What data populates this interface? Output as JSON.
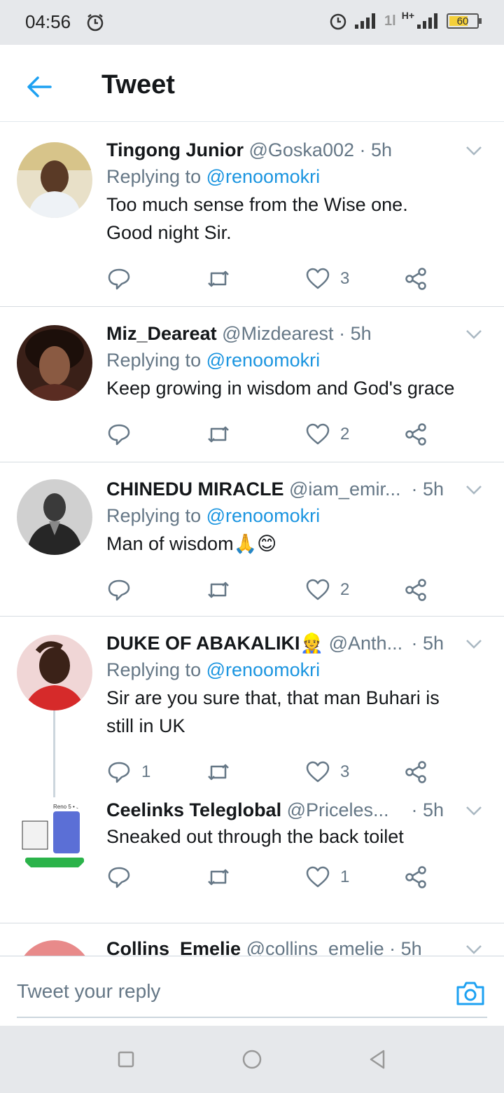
{
  "status_bar": {
    "time": "04:56",
    "network": "H+",
    "sim2_signal": "1l",
    "battery_level": "60"
  },
  "header": {
    "title": "Tweet"
  },
  "tweets": [
    {
      "name": "Tingong Junior",
      "handle": "@Goska002",
      "sep": "·",
      "time": "5h",
      "replying_prefix": "Replying to",
      "replying_to": "@renoomokri",
      "text_lines": [
        "Too much sense from the Wise one.",
        "Good night Sir."
      ],
      "reply_count": "",
      "like_count": "3"
    },
    {
      "name": "Miz_Deareat",
      "handle": "@Mizdearest",
      "sep": "·",
      "time": "5h",
      "replying_prefix": "Replying to",
      "replying_to": "@renoomokri",
      "text_lines": [
        "Keep growing in wisdom and God's grace"
      ],
      "reply_count": "",
      "like_count": "2"
    },
    {
      "name": "CHINEDU MIRACLE",
      "handle": "@iam_emir...",
      "sep": "·",
      "time": "5h",
      "replying_prefix": "Replying to",
      "replying_to": "@renoomokri",
      "text_lines": [
        "Man of wisdom🙏😊"
      ],
      "reply_count": "",
      "like_count": "2"
    },
    {
      "name": "DUKE OF ABAKALIKI👷",
      "handle": "@Anth...",
      "sep": "·",
      "time": "5h",
      "replying_prefix": "Replying to",
      "replying_to": "@renoomokri",
      "text_lines": [
        "Sir are you sure that, that man Buhari is",
        "still in UK"
      ],
      "reply_count": "1",
      "like_count": "3"
    },
    {
      "name": "Ceelinks Teleglobal",
      "handle": "@Priceles...",
      "sep": "·",
      "time": "5h",
      "text_lines": [
        "Sneaked out through the back toilet"
      ],
      "reply_count": "",
      "like_count": "1",
      "avatar_text": "Reno 5 • 5."
    },
    {
      "name": "Collins_Emelie",
      "handle": "@collins_emelie",
      "sep": "·",
      "time": "5h"
    }
  ],
  "reply_bar": {
    "placeholder": "Tweet your reply"
  },
  "colors": {
    "link": "#1b95e0",
    "muted": "#657786",
    "text": "#14171a",
    "divider": "#d6dce1"
  }
}
